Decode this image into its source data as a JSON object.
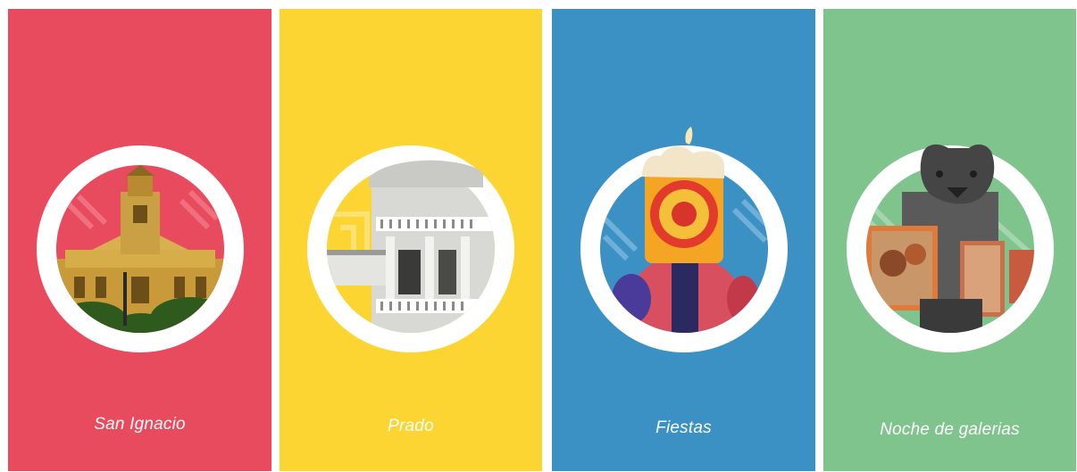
{
  "cards": [
    {
      "label": "San Ignacio",
      "color": "#e84a5e",
      "icon": "building-icon"
    },
    {
      "label": "Prado",
      "color": "#fcd533",
      "icon": "colonial-house-icon"
    },
    {
      "label": "Fiestas",
      "color": "#3c91c4",
      "icon": "candle-icon"
    },
    {
      "label": "Noche de galerias",
      "color": "#7fc48c",
      "icon": "jaguar-gallery-icon"
    }
  ]
}
